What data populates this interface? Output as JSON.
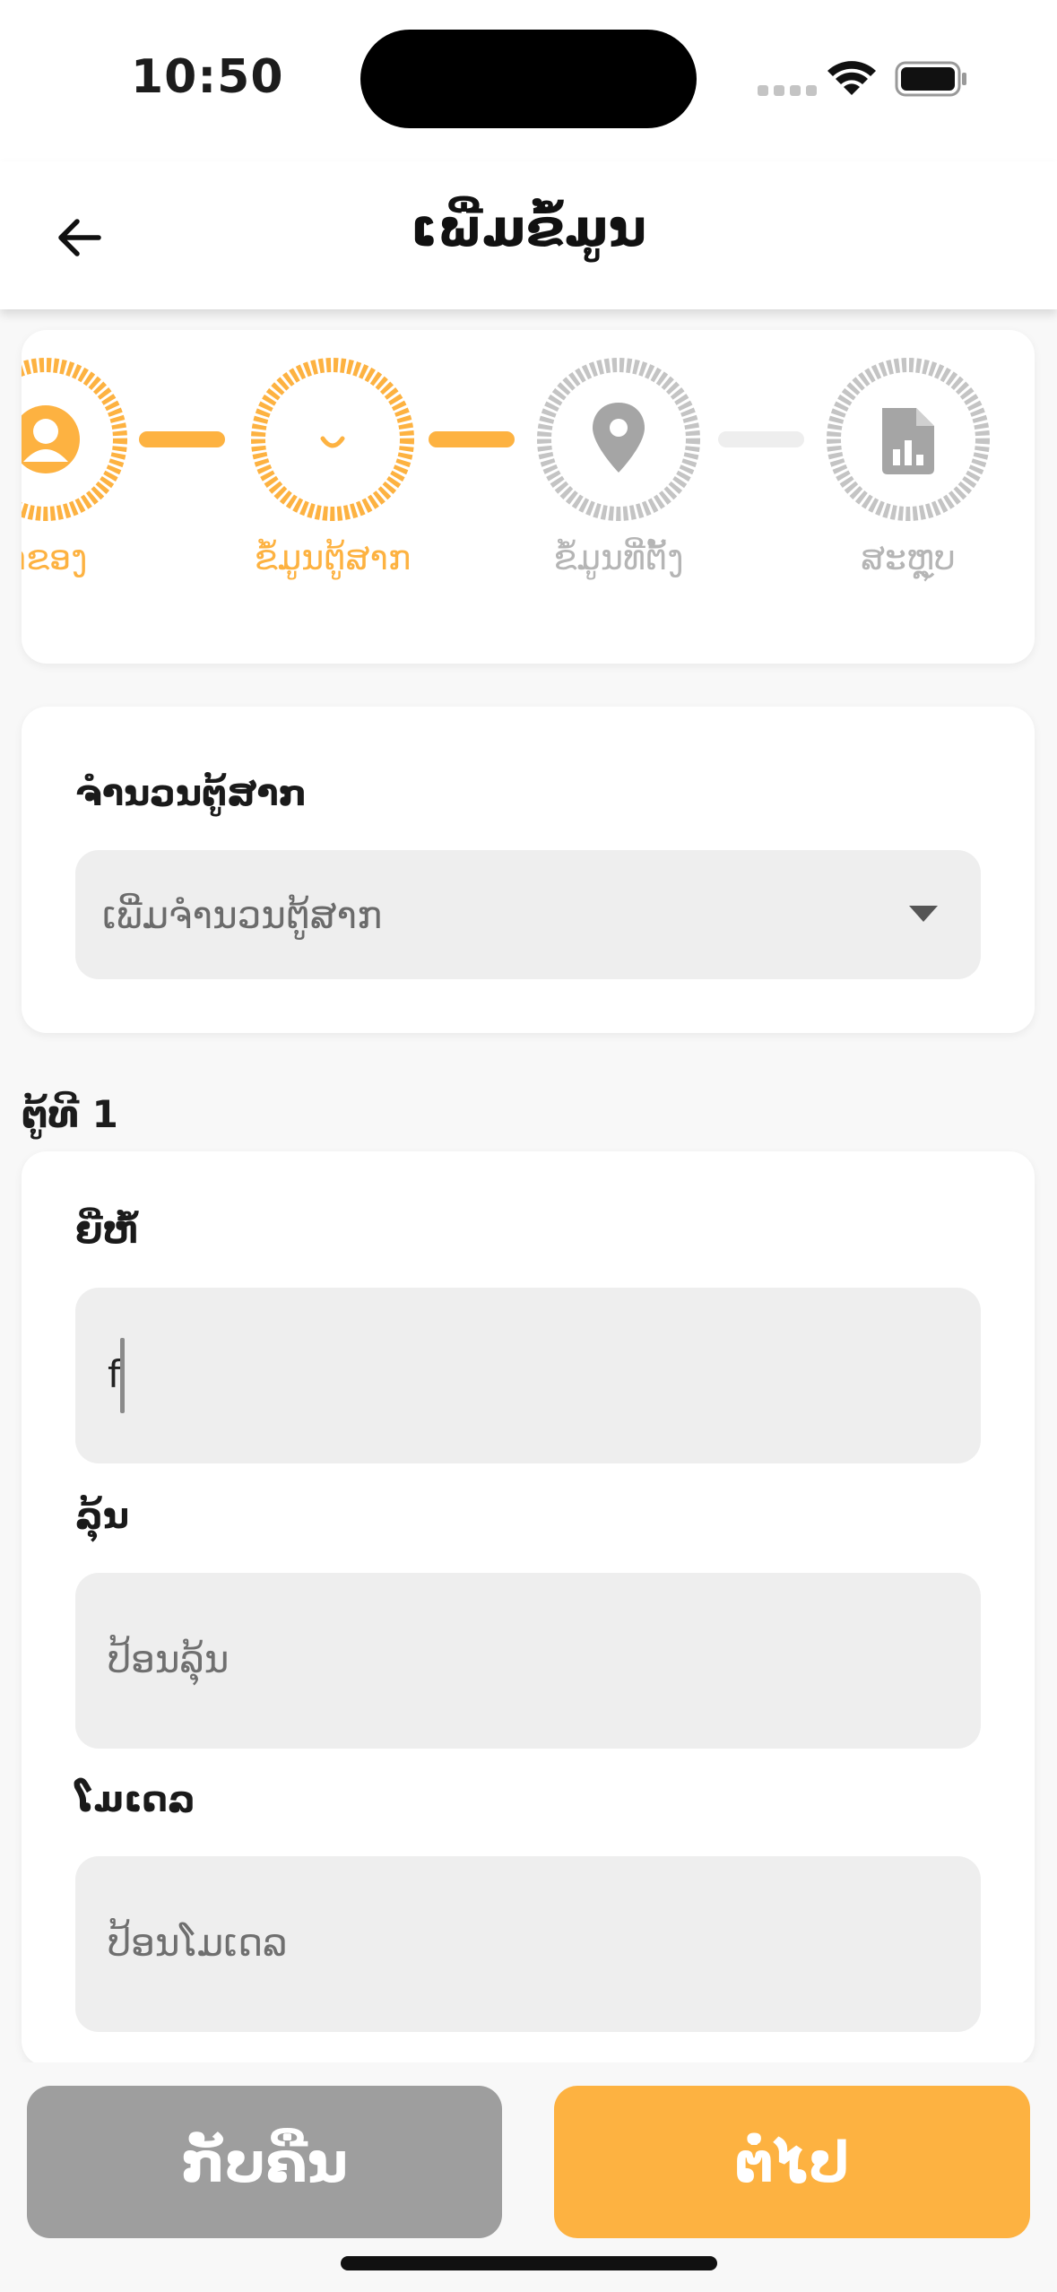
{
  "status_bar": {
    "time": "10:50"
  },
  "header": {
    "title": "ເພີ່ມຂໍ້ມູນ",
    "back_icon": "arrow-left-icon"
  },
  "stepper": {
    "steps": [
      {
        "label": "ເຈົ້າຂອງ",
        "icon": "person-icon",
        "state": "completed"
      },
      {
        "label": "ຂໍ້ມູນຕູ້ສາກ",
        "icon": "smile-icon",
        "state": "active"
      },
      {
        "label": "ຂໍ້ມູນທີ່ຕັ້ງ",
        "icon": "location-pin-icon",
        "state": "pending"
      },
      {
        "label": "ສະຫຼຸບ",
        "icon": "report-icon",
        "state": "pending"
      }
    ]
  },
  "quantity": {
    "label": "ຈຳນວນຕູ້ສາກ",
    "placeholder": "ເພີ່ມຈຳນວນຕູ້ສາກ"
  },
  "section": {
    "title": "ຕູ້ທີ 1"
  },
  "fields": {
    "brand": {
      "label": "ຍີ່ຫໍ້",
      "value": "f"
    },
    "category": {
      "label": "ລຸ້ນ",
      "placeholder": "ປ້ອນລຸ້ນ"
    },
    "model": {
      "label": "ໂມເດລ",
      "placeholder": "ປ້ອນໂມເດລ"
    }
  },
  "buttons": {
    "back_label": "ກັບຄືນ",
    "next_label": "ຕໍ່ໄປ"
  },
  "colors": {
    "accent": "#fdb241",
    "inactive": "#c4c4c4",
    "button_grey": "#9e9e9e"
  }
}
